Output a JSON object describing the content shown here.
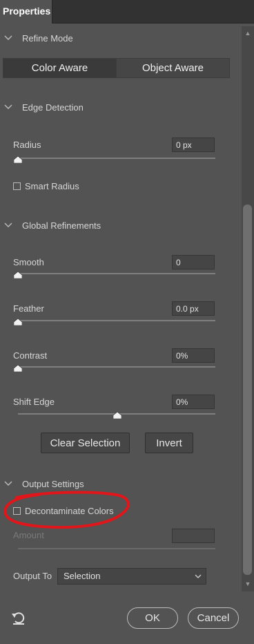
{
  "tabs": [
    {
      "label": "Properties"
    }
  ],
  "refine_mode": {
    "title": "Refine Mode",
    "options": [
      "Color Aware",
      "Object Aware"
    ],
    "selected": "Color Aware"
  },
  "edge_detection": {
    "title": "Edge Detection",
    "radius": {
      "label": "Radius",
      "value": "0 px",
      "slider_fraction": 0
    },
    "smart_radius": {
      "label": "Smart Radius",
      "checked": false
    }
  },
  "global_refinements": {
    "title": "Global Refinements",
    "smooth": {
      "label": "Smooth",
      "value": "0",
      "slider_fraction": 0
    },
    "feather": {
      "label": "Feather",
      "value": "0.0 px",
      "slider_fraction": 0
    },
    "contrast": {
      "label": "Contrast",
      "value": "0%",
      "slider_fraction": 0
    },
    "shift_edge": {
      "label": "Shift Edge",
      "value": "0%",
      "slider_fraction": 0.5
    },
    "clear_selection_label": "Clear Selection",
    "invert_label": "Invert"
  },
  "output_settings": {
    "title": "Output Settings",
    "decontaminate": {
      "label": "Decontaminate Colors",
      "checked": false
    },
    "amount": {
      "label": "Amount",
      "value": "",
      "disabled": true
    },
    "output_to": {
      "label": "Output To",
      "selected": "Selection"
    }
  },
  "footer": {
    "reset_icon": "reset-icon",
    "ok_label": "OK",
    "cancel_label": "Cancel"
  },
  "annotation": {
    "color": "#e0161b"
  },
  "colors": {
    "panel": "#535353",
    "tab_bar": "#323232",
    "field": "#454545"
  }
}
